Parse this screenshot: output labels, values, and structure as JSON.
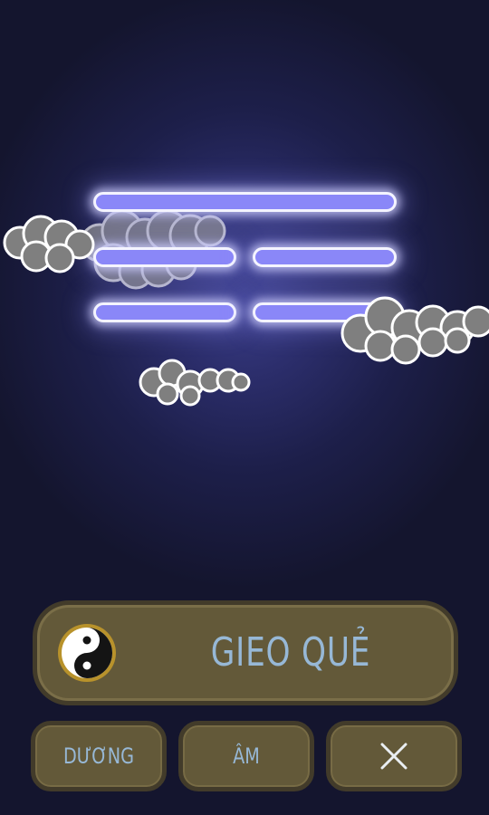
{
  "colors": {
    "background": "#14152e",
    "glow": "#3c3f8c",
    "line_fill": "#8a87f8",
    "line_border": "#f4f4ff",
    "button_fill": "#635939",
    "button_border": "#423b2a",
    "button_text": "#97b8d6",
    "cloud_fill": "#808080",
    "cloud_outline": "#ffffff"
  },
  "hexagram": {
    "lines": [
      {
        "type": "yang"
      },
      {
        "type": "yin"
      },
      {
        "type": "yin"
      }
    ]
  },
  "main_button": {
    "icon": "yin-yang-icon",
    "label": "GIEO QUẺ"
  },
  "bottom_buttons": {
    "duong_label": "DƯƠNG",
    "am_label": "ÂM",
    "close_icon": "close-icon"
  }
}
